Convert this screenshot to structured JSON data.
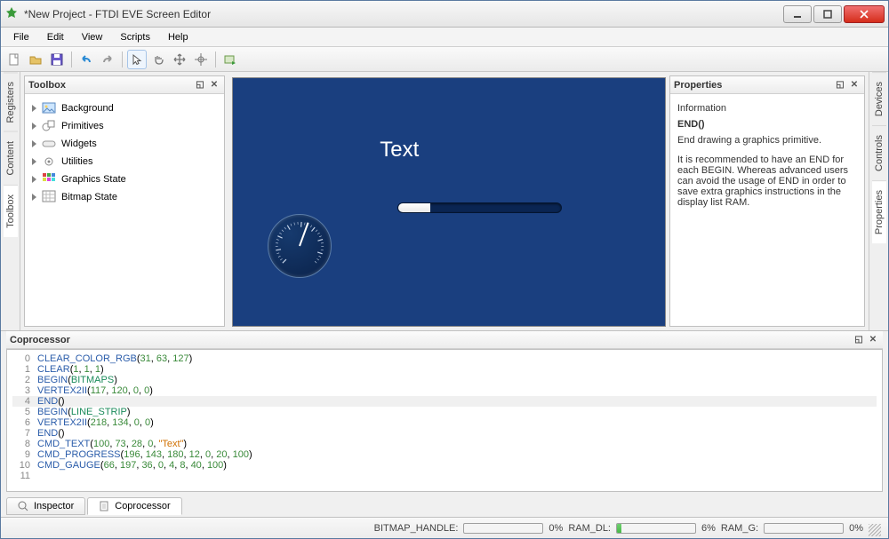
{
  "window": {
    "title": "*New Project - FTDI EVE Screen Editor"
  },
  "menu": [
    "File",
    "Edit",
    "View",
    "Scripts",
    "Help"
  ],
  "toolbox": {
    "title": "Toolbox",
    "items": [
      {
        "label": "Background",
        "icon": "image"
      },
      {
        "label": "Primitives",
        "icon": "shapes"
      },
      {
        "label": "Widgets",
        "icon": "widget"
      },
      {
        "label": "Utilities",
        "icon": "gear"
      },
      {
        "label": "Graphics State",
        "icon": "grid"
      },
      {
        "label": "Bitmap State",
        "icon": "bitmap"
      }
    ]
  },
  "side_left": [
    "Registers",
    "Content",
    "Toolbox"
  ],
  "side_right": [
    "Devices",
    "Controls",
    "Properties"
  ],
  "canvas": {
    "bg_color": "#1a3f7f",
    "text_value": "Text",
    "progress_pct": 20,
    "gauge_angle_deg": 200
  },
  "properties": {
    "title": "Properties",
    "section": "Information",
    "cmd": "END()",
    "desc1": "End drawing a graphics primitive.",
    "desc2": "It is recommended to have an END for each BEGIN. Whereas advanced users can avoid the usage of END in order to save extra graphics instructions in the display list RAM."
  },
  "coprocessor": {
    "title": "Coprocessor",
    "selected_line": 4,
    "lines": [
      {
        "n": 0,
        "tokens": [
          [
            "kw",
            "CLEAR_COLOR_RGB"
          ],
          [
            "",
            "("
          ],
          [
            "num",
            "31"
          ],
          [
            "",
            ", "
          ],
          [
            "num",
            "63"
          ],
          [
            "",
            ", "
          ],
          [
            "num",
            "127"
          ],
          [
            "",
            ")"
          ]
        ]
      },
      {
        "n": 1,
        "tokens": [
          [
            "kw",
            "CLEAR"
          ],
          [
            "",
            "("
          ],
          [
            "num",
            "1"
          ],
          [
            "",
            ", "
          ],
          [
            "num",
            "1"
          ],
          [
            "",
            ", "
          ],
          [
            "num",
            "1"
          ],
          [
            "",
            ")"
          ]
        ]
      },
      {
        "n": 2,
        "tokens": [
          [
            "kw",
            "BEGIN"
          ],
          [
            "",
            "("
          ],
          [
            "kw2",
            "BITMAPS"
          ],
          [
            "",
            ")"
          ]
        ]
      },
      {
        "n": 3,
        "tokens": [
          [
            "kw",
            "VERTEX2II"
          ],
          [
            "",
            "("
          ],
          [
            "num",
            "117"
          ],
          [
            "",
            ", "
          ],
          [
            "num",
            "120"
          ],
          [
            "",
            ", "
          ],
          [
            "num",
            "0"
          ],
          [
            "",
            ", "
          ],
          [
            "num",
            "0"
          ],
          [
            "",
            ")"
          ]
        ]
      },
      {
        "n": 4,
        "tokens": [
          [
            "kw",
            "END"
          ],
          [
            "",
            "()"
          ]
        ]
      },
      {
        "n": 5,
        "tokens": [
          [
            "kw",
            "BEGIN"
          ],
          [
            "",
            "("
          ],
          [
            "kw2",
            "LINE_STRIP"
          ],
          [
            "",
            ")"
          ]
        ]
      },
      {
        "n": 6,
        "tokens": [
          [
            "kw",
            "VERTEX2II"
          ],
          [
            "",
            "("
          ],
          [
            "num",
            "218"
          ],
          [
            "",
            ", "
          ],
          [
            "num",
            "134"
          ],
          [
            "",
            ", "
          ],
          [
            "num",
            "0"
          ],
          [
            "",
            ", "
          ],
          [
            "num",
            "0"
          ],
          [
            "",
            ")"
          ]
        ]
      },
      {
        "n": 7,
        "tokens": [
          [
            "kw",
            "END"
          ],
          [
            "",
            "()"
          ]
        ]
      },
      {
        "n": 8,
        "tokens": [
          [
            "kw",
            "CMD_TEXT"
          ],
          [
            "",
            "("
          ],
          [
            "num",
            "100"
          ],
          [
            "",
            ", "
          ],
          [
            "num",
            "73"
          ],
          [
            "",
            ", "
          ],
          [
            "num",
            "28"
          ],
          [
            "",
            ", "
          ],
          [
            "num",
            "0"
          ],
          [
            "",
            ", "
          ],
          [
            "str",
            "\"Text\""
          ],
          [
            "",
            ")"
          ]
        ]
      },
      {
        "n": 9,
        "tokens": [
          [
            "kw",
            "CMD_PROGRESS"
          ],
          [
            "",
            "("
          ],
          [
            "num",
            "196"
          ],
          [
            "",
            ", "
          ],
          [
            "num",
            "143"
          ],
          [
            "",
            ", "
          ],
          [
            "num",
            "180"
          ],
          [
            "",
            ", "
          ],
          [
            "num",
            "12"
          ],
          [
            "",
            ", "
          ],
          [
            "num",
            "0"
          ],
          [
            "",
            ", "
          ],
          [
            "num",
            "20"
          ],
          [
            "",
            ", "
          ],
          [
            "num",
            "100"
          ],
          [
            "",
            ")"
          ]
        ]
      },
      {
        "n": 10,
        "tokens": [
          [
            "kw",
            "CMD_GAUGE"
          ],
          [
            "",
            "("
          ],
          [
            "num",
            "66"
          ],
          [
            "",
            ", "
          ],
          [
            "num",
            "197"
          ],
          [
            "",
            ", "
          ],
          [
            "num",
            "36"
          ],
          [
            "",
            ", "
          ],
          [
            "num",
            "0"
          ],
          [
            "",
            ", "
          ],
          [
            "num",
            "4"
          ],
          [
            "",
            ", "
          ],
          [
            "num",
            "8"
          ],
          [
            "",
            ", "
          ],
          [
            "num",
            "40"
          ],
          [
            "",
            ", "
          ],
          [
            "num",
            "100"
          ],
          [
            "",
            ")"
          ]
        ]
      },
      {
        "n": 11,
        "tokens": []
      }
    ]
  },
  "bottom_tabs": {
    "inspector": "Inspector",
    "coprocessor": "Coprocessor"
  },
  "status": {
    "bitmap_handle": {
      "label": "BITMAP_HANDLE:",
      "pct": 0,
      "text": "0%"
    },
    "ram_dl": {
      "label": "RAM_DL:",
      "pct": 6,
      "text": "6%"
    },
    "ram_g": {
      "label": "RAM_G:",
      "pct": 0,
      "text": "0%"
    }
  }
}
